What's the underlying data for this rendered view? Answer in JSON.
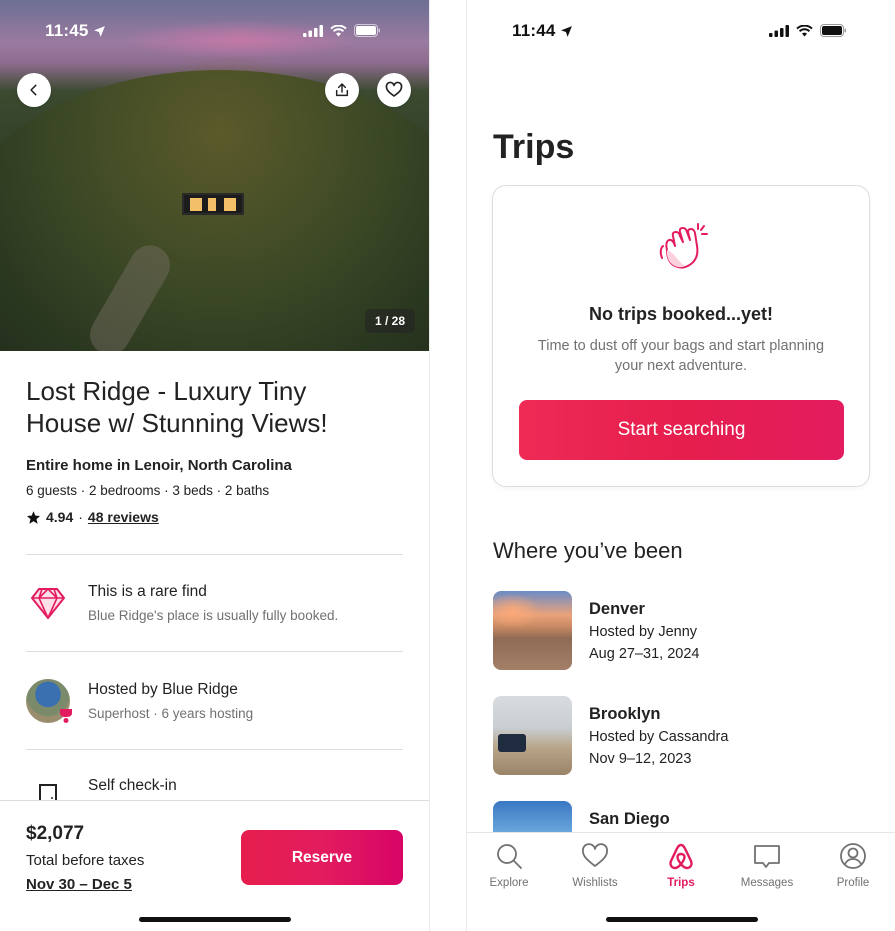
{
  "left_phone": {
    "status_bar": {
      "time": "11:45"
    },
    "hero": {
      "photo_counter": "1 / 28"
    },
    "listing": {
      "title": "Lost Ridge - Luxury Tiny House w/ Stunning Views!",
      "subtitle": "Entire home in Lenoir, North Carolina",
      "meta": "6 guests · 2 bedrooms · 3 beds · 2 baths",
      "rating": "4.94",
      "rating_separator": "·",
      "reviews_link": "48 reviews"
    },
    "features": [
      {
        "icon": "diamond-icon",
        "title": "This is a rare find",
        "desc": "Blue Ridge's place is usually fully booked."
      },
      {
        "icon": "host-avatar",
        "title": "Hosted by Blue Ridge",
        "desc": "Superhost · 6 years hosting"
      },
      {
        "icon": "door-icon",
        "title": "Self check-in",
        "desc": ""
      }
    ],
    "footer": {
      "price": "$2,077",
      "price_label": "Total before taxes",
      "dates": "Nov 30 – Dec 5",
      "reserve_label": "Reserve"
    }
  },
  "right_phone": {
    "status_bar": {
      "time": "11:44"
    },
    "page_title": "Trips",
    "empty_state": {
      "title": "No trips booked...yet!",
      "description": "Time to dust off your bags and start planning your next adventure.",
      "button_label": "Start searching"
    },
    "history_title": "Where you’ve been",
    "past_trips": [
      {
        "city": "Denver",
        "host": "Hosted by Jenny",
        "dates": "Aug 27–31, 2024"
      },
      {
        "city": "Brooklyn",
        "host": "Hosted by Cassandra",
        "dates": "Nov 9–12, 2023"
      },
      {
        "city": "San Diego",
        "host": "",
        "dates": ""
      }
    ],
    "tab_bar": {
      "active": "Trips",
      "tabs": [
        {
          "label": "Explore",
          "icon": "search-icon"
        },
        {
          "label": "Wishlists",
          "icon": "heart-icon"
        },
        {
          "label": "Trips",
          "icon": "airbnb-logo-icon"
        },
        {
          "label": "Messages",
          "icon": "message-icon"
        },
        {
          "label": "Profile",
          "icon": "profile-icon"
        }
      ]
    }
  },
  "colors": {
    "brand": "#e31c5f",
    "brand_gradient_start": "#e61e4d",
    "brand_gradient_end": "#d70466",
    "text_primary": "#222222",
    "text_secondary": "#717171",
    "divider": "#dddddd"
  }
}
